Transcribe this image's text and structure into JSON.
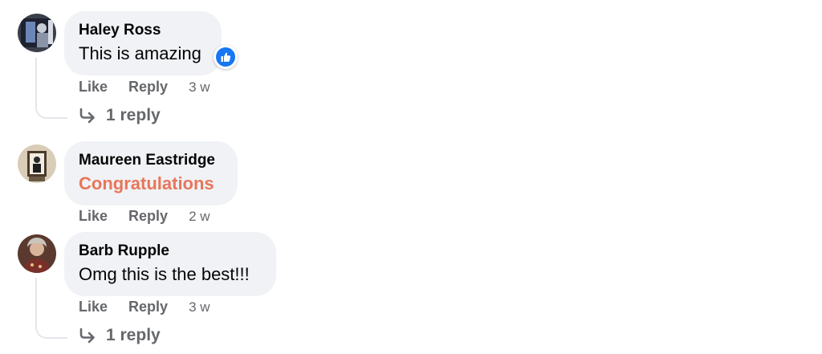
{
  "comments": [
    {
      "author": "Haley Ross",
      "text": "This is amazing",
      "reaction_icon": "like-icon",
      "actions": {
        "like": "Like",
        "reply": "Reply",
        "time": "3 w"
      },
      "replies": "1 reply"
    },
    {
      "author": "Maureen Eastridge",
      "text": "Congratulations",
      "text_color": "#e8765a",
      "actions": {
        "like": "Like",
        "reply": "Reply",
        "time": "2 w"
      }
    },
    {
      "author": "Barb Rupple",
      "text": "Omg this is the best!!!",
      "actions": {
        "like": "Like",
        "reply": "Reply",
        "time": "3 w"
      },
      "replies": "1 reply"
    }
  ],
  "colors": {
    "bubble": "#f0f2f5",
    "secondary_text": "#65676b",
    "like_blue": "#1877f2"
  }
}
